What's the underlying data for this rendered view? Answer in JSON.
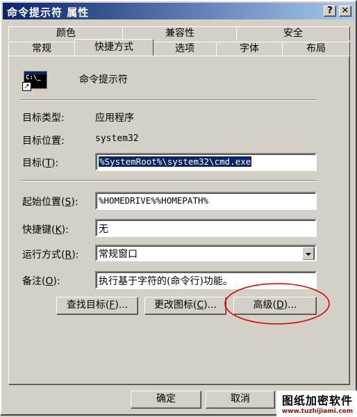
{
  "window": {
    "title": "命令提示符 属性",
    "help_label": "?",
    "close_label": "✕"
  },
  "tabs": {
    "row_back": [
      "颜色",
      "兼容性",
      "安全"
    ],
    "row_front": [
      "常规",
      "快捷方式",
      "选项",
      "字体",
      "布局"
    ],
    "selected": "快捷方式"
  },
  "shortcut": {
    "name": "命令提示符",
    "icon_text": "C:\\_",
    "target_type_label": "目标类型:",
    "target_type_value": "应用程序",
    "target_location_label": "目标位置:",
    "target_location_value": "system32",
    "target_label": "目标(",
    "target_key": "T",
    "target_label_end": "):",
    "target_value": "%SystemRoot%\\system32\\cmd.exe",
    "start_in_label": "起始位置(",
    "start_in_key": "S",
    "start_in_label_end": "):",
    "start_in_value": "%HOMEDRIVE%%HOMEPATH%",
    "hotkey_label": "快捷键(",
    "hotkey_key": "K",
    "hotkey_label_end": "):",
    "hotkey_value": "无",
    "run_label": "运行方式(",
    "run_key": "R",
    "run_label_end": "):",
    "run_value": "常规窗口",
    "comment_label": "备注(",
    "comment_key": "O",
    "comment_label_end": "):",
    "comment_value": "执行基于字符的(命令行)功能。"
  },
  "buttons": {
    "find_target_label": "查找目标(",
    "find_target_key": "F",
    "find_target_end": ")...",
    "change_icon_label": "更改图标(",
    "change_icon_key": "C",
    "change_icon_end": ")...",
    "advanced_label": "高级(",
    "advanced_key": "D",
    "advanced_end": ")...",
    "ok_label": "确定",
    "cancel_label": "取消"
  },
  "watermark": {
    "text": "图纸加密软件",
    "url": "www.tuzhijiami.com"
  },
  "colors": {
    "face": "#d4d0c8",
    "title_start": "#0a246a",
    "title_end": "#a6caf0",
    "selection": "#0a246a",
    "annotation": "#e00000"
  }
}
